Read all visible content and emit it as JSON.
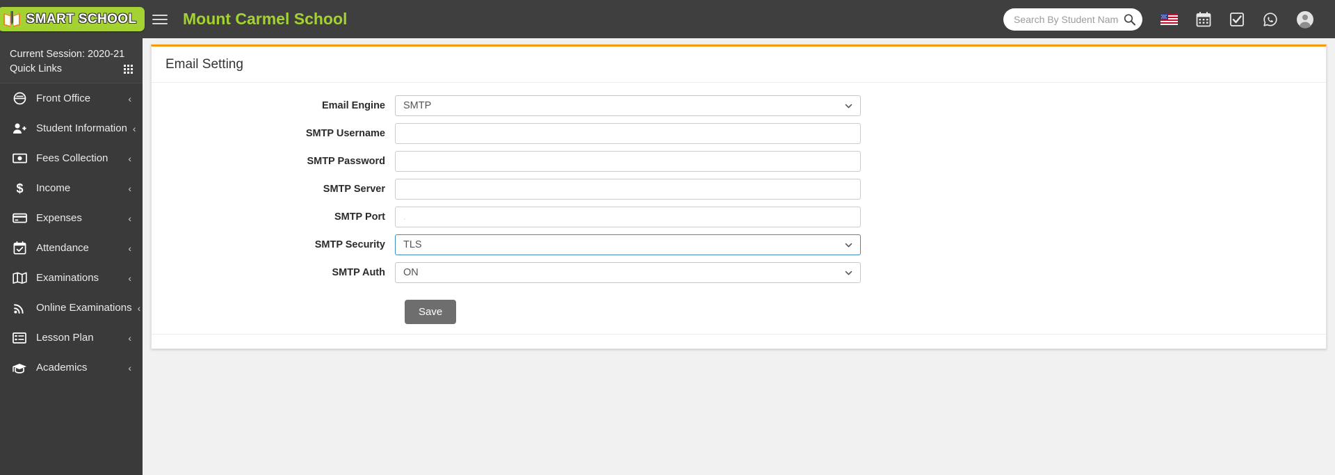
{
  "topbar": {
    "logo_text": "SMART SCHOOL",
    "logo_icon": "open-book-icon",
    "menu_toggle_icon": "hamburger-icon",
    "school_name": "Mount Carmel School",
    "search": {
      "placeholder": "Search By Student Name, Roll Number",
      "value": ""
    },
    "search_icon": "search-icon",
    "icons": [
      {
        "name": "language-flag-icon",
        "label": "US"
      },
      {
        "name": "calendar-icon",
        "label": "Calendar"
      },
      {
        "name": "checkbox-icon",
        "label": "Tasks"
      },
      {
        "name": "whatsapp-icon",
        "label": "WhatsApp"
      },
      {
        "name": "user-avatar-icon",
        "label": "Account"
      }
    ]
  },
  "sidebar": {
    "session_label": "Current Session: 2020-21",
    "quick_links_label": "Quick Links",
    "quick_links_icon": "grid-icon",
    "caret": "‹",
    "items": [
      {
        "label": "Front Office",
        "icon": "front-office-icon"
      },
      {
        "label": "Student Information",
        "icon": "student-add-icon"
      },
      {
        "label": "Fees Collection",
        "icon": "money-note-icon"
      },
      {
        "label": "Income",
        "icon": "dollar-icon"
      },
      {
        "label": "Expenses",
        "icon": "credit-card-icon"
      },
      {
        "label": "Attendance",
        "icon": "calendar-check-icon"
      },
      {
        "label": "Examinations",
        "icon": "book-open-icon"
      },
      {
        "label": "Online Examinations",
        "icon": "rss-icon"
      },
      {
        "label": "Lesson Plan",
        "icon": "list-alt-icon"
      },
      {
        "label": "Academics",
        "icon": "graduation-cap-icon"
      }
    ]
  },
  "panel": {
    "title": "Email Setting",
    "accent_color": "#f39c12",
    "fields": [
      {
        "label": "Email Engine",
        "type": "select",
        "value": "SMTP",
        "focused": false
      },
      {
        "label": "SMTP Username",
        "type": "text",
        "value": "",
        "placeholder": ""
      },
      {
        "label": "SMTP Password",
        "type": "text",
        "value": "",
        "placeholder": ""
      },
      {
        "label": "SMTP Server",
        "type": "text",
        "value": "",
        "placeholder": ""
      },
      {
        "label": "SMTP Port",
        "type": "text",
        "value": "",
        "placeholder": "."
      },
      {
        "label": "SMTP Security",
        "type": "select",
        "value": "TLS",
        "focused": true
      },
      {
        "label": "SMTP Auth",
        "type": "select",
        "value": "ON",
        "focused": false
      }
    ],
    "save_label": "Save"
  }
}
